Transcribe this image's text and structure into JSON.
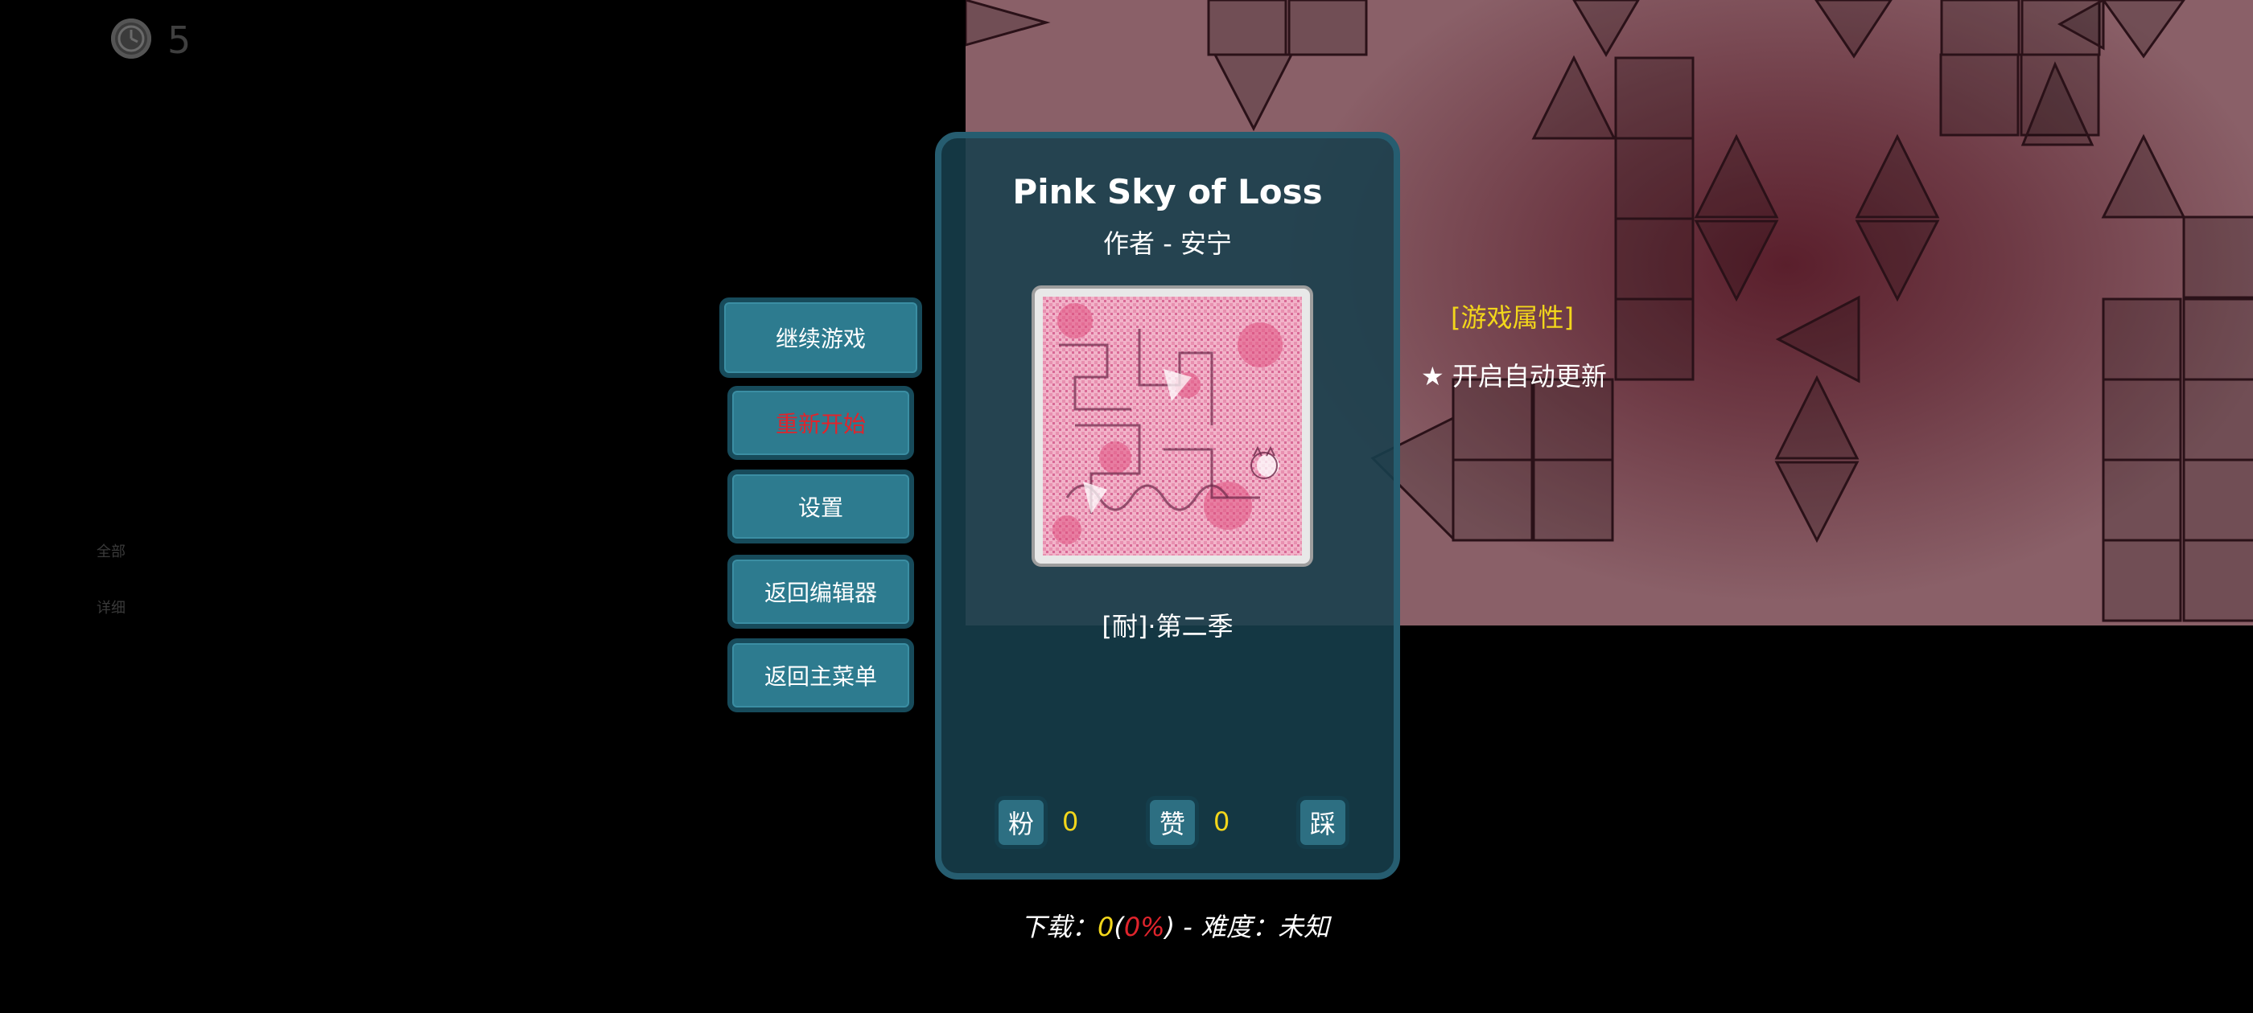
{
  "hud": {
    "clock_icon": "clock-icon",
    "count": "5",
    "side_labels": [
      "全部",
      "详细"
    ]
  },
  "menu": {
    "continue": "继续游戏",
    "restart": "重新开始",
    "settings": "设置",
    "back_editor": "返回编辑器",
    "back_main": "返回主菜单"
  },
  "level": {
    "title": "Pink Sky of Loss",
    "author": "作者 - 安宁",
    "tag": "[耐]·第二季"
  },
  "votes": {
    "fans_label": "粉",
    "fans_count": "0",
    "likes_label": "赞",
    "likes_count": "0",
    "dislike_label": "踩"
  },
  "properties": {
    "title": "[游戏属性]",
    "item": "★ 开启自动更新"
  },
  "stats": {
    "downloads_label": "下载：",
    "downloads_value": "0",
    "open_paren": "(",
    "downloads_percent": "0%",
    "close_paren": ")",
    "separator": " - ",
    "difficulty_label": "难度：",
    "difficulty_value": "未知"
  },
  "colors": {
    "button": "#2d7b8f",
    "button_border": "#174b5b",
    "card": "#173f4c",
    "accent_yellow": "#f2d61b",
    "accent_red": "#e0242c"
  }
}
